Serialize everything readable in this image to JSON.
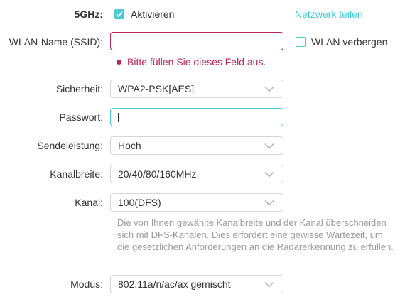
{
  "band": {
    "label": "5GHz:",
    "enable_label": "Aktivieren",
    "enabled": true,
    "share_link": "Netzwerk teilen"
  },
  "ssid": {
    "label": "WLAN-Name (SSID):",
    "value": "",
    "error": "Bitte füllen Sie dieses Feld aus.",
    "hide_label": "WLAN verbergen",
    "hidden": false
  },
  "security": {
    "label": "Sicherheit:",
    "value": "WPA2-PSK[AES]"
  },
  "password": {
    "label": "Passwort:",
    "value": ""
  },
  "tx_power": {
    "label": "Sendeleistung:",
    "value": "Hoch"
  },
  "channel_width": {
    "label": "Kanalbreite:",
    "value": "20/40/80/160MHz"
  },
  "channel": {
    "label": "Kanal:",
    "value": "100(DFS)",
    "note": "Die von Ihnen gewählte Kanalbreite und der Kanal überschneiden sich mit DFS-Kanälen. Dies erfordert eine gewisse Wartezeit, um die gesetzlichen Anforderungen an die Radarerkennung zu erfüllen."
  },
  "mode": {
    "label": "Modus:",
    "value": "802.11a/n/ac/ax gemischt"
  },
  "colors": {
    "accent": "#4acbd6",
    "error": "#b8245c",
    "note_text": "#9a9a9a",
    "border": "#d6d6d6"
  },
  "icons": {
    "select_arrow": "chevron-down-icon",
    "checkbox_checked": "checkmark-icon"
  }
}
